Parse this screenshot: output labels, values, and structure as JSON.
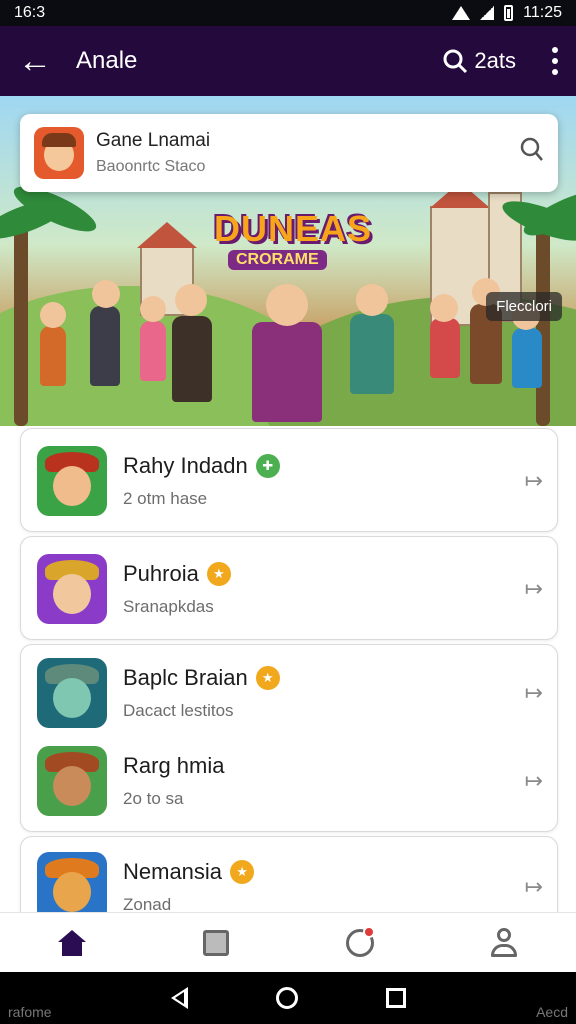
{
  "status": {
    "time": "16:3",
    "clock_right": "11:25"
  },
  "app_bar": {
    "title": "Anale",
    "search_label": "2ats"
  },
  "banner": {
    "game_title": "DUNEAS",
    "game_subtitle": "CRORAME",
    "search_card": {
      "title": "Gane Lnamai",
      "subtitle": "Baoonrtc Staco"
    },
    "chip_label": "Flecclori"
  },
  "list": [
    {
      "title": "Rahy Indadn",
      "subtitle": "2 otm hase",
      "badge_color": "#4caf50",
      "thumb_bg": "#3aa345",
      "hat": "#b8321e",
      "face": "#f1bc8c"
    },
    {
      "title": "Puhroia",
      "subtitle": "Sranapkdas",
      "badge_color": "#f2a81d",
      "thumb_bg": "#8a3cc8",
      "hat": "#d9a52a",
      "face": "#f1c89e"
    },
    {
      "title": "Baplc Braian",
      "subtitle": "Dacact lestitos",
      "badge_color": "#f2a81d",
      "thumb_bg": "#1e6a78",
      "hat": "#5d8a7a",
      "face": "#7fc7b0"
    },
    {
      "title": "Rarg hmia",
      "subtitle": "2o to sa",
      "badge_color": "",
      "thumb_bg": "#4aa04a",
      "hat": "#a24a22",
      "face": "#c98b5a"
    },
    {
      "title": "Nemansia",
      "subtitle": "Zonad",
      "badge_color": "#f2a81d",
      "thumb_bg": "#2a74c8",
      "hat": "#e07a1e",
      "face": "#e8a54c"
    }
  ],
  "system": {
    "left_label": "rafome",
    "right_label": "Aecd"
  }
}
